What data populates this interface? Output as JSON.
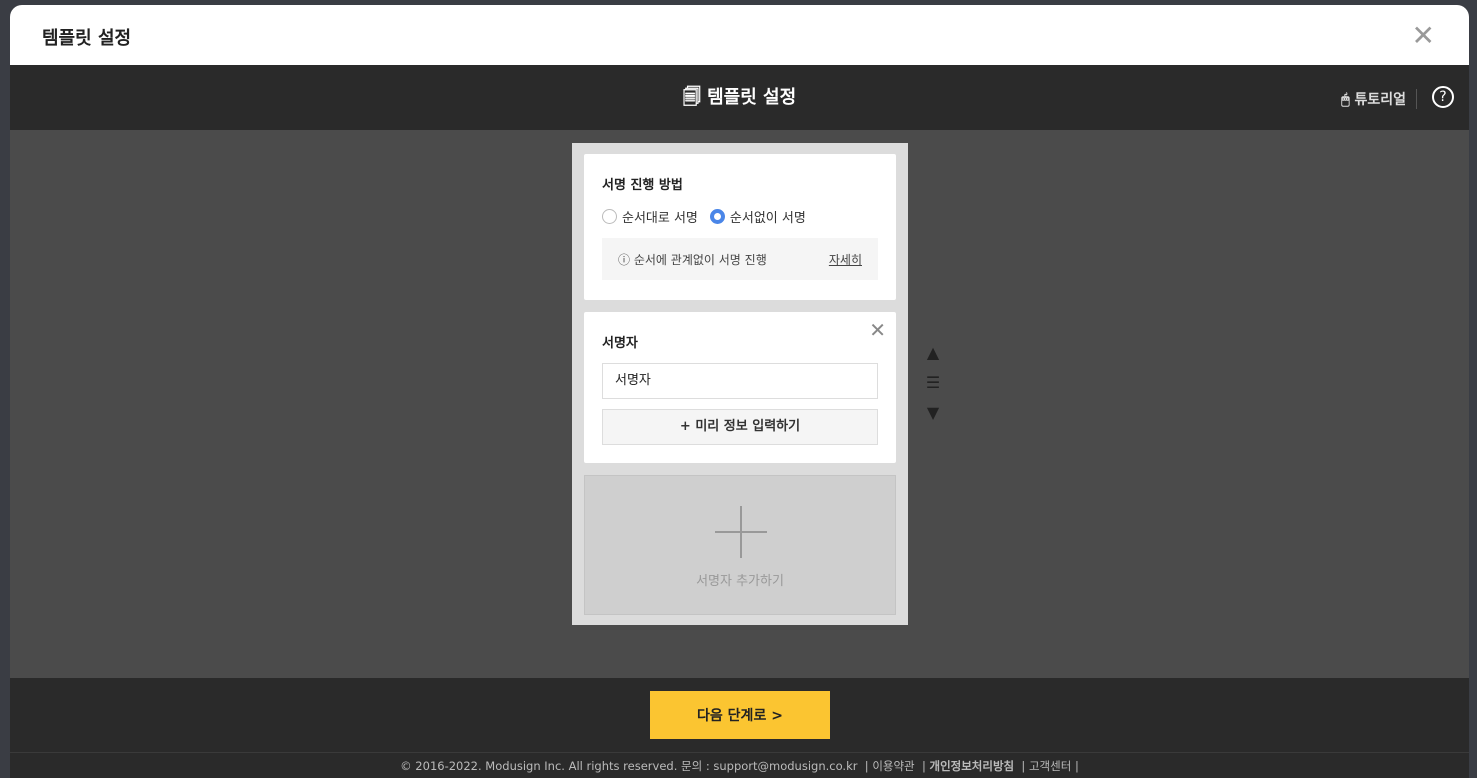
{
  "modal": {
    "title": "템플릿 설정",
    "close_icon": "close-icon"
  },
  "toolbar": {
    "title": "템플릿 설정",
    "tutorial": "튜토리얼",
    "help": "?"
  },
  "method": {
    "heading": "서명 진행 방법",
    "options": [
      {
        "label": "순서대로 서명",
        "selected": false
      },
      {
        "label": "순서없이 서명",
        "selected": true
      }
    ],
    "info": "순서에 관계없이 서명 진행",
    "detail_link": "자세히"
  },
  "signer": {
    "heading": "서명자",
    "name_value": "서명자",
    "prefill_button": "+ 미리 정보 입력하기"
  },
  "add_signer": "서명자 추가하기",
  "footer": {
    "next_button": "다음 단계로 >",
    "copyright": "© 2016-2022. Modusign Inc. All rights reserved.  문의 : support@modusign.co.kr",
    "links": [
      "이용약관",
      "개인정보처리방침",
      "고객센터"
    ]
  },
  "colors": {
    "accent": "#fbc531",
    "radio": "#4a86e8"
  }
}
